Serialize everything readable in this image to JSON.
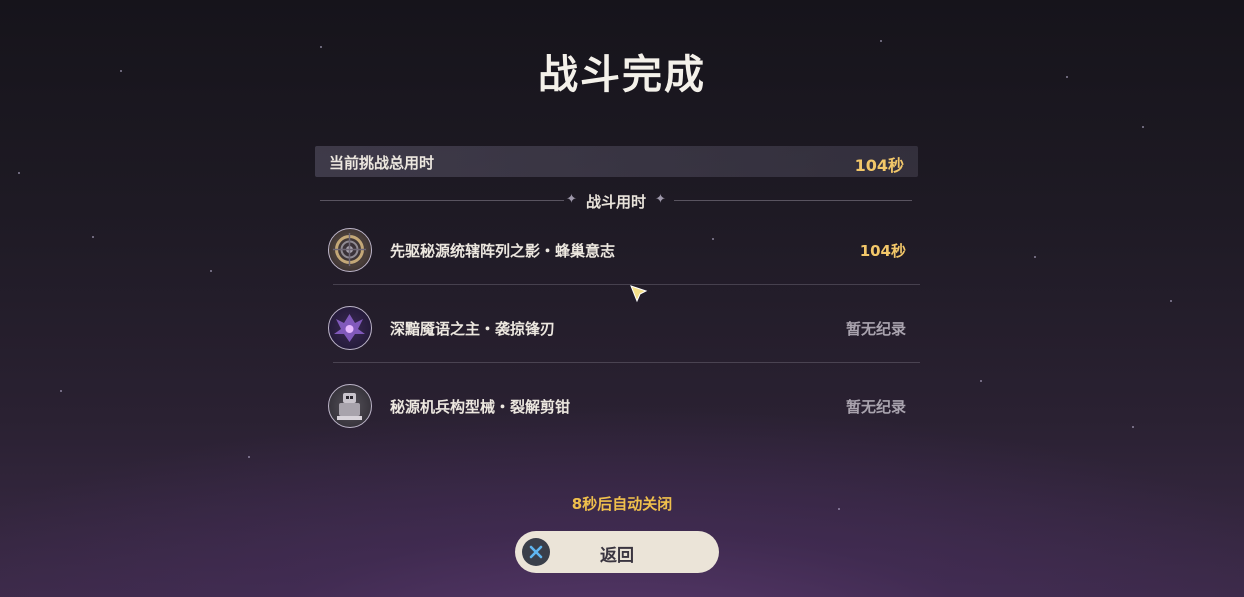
{
  "title": "战斗完成",
  "total": {
    "label": "当前挑战总用时",
    "value": "104秒"
  },
  "section": {
    "label": "战斗用时"
  },
  "bosses": [
    {
      "name": "先驱秘源统辖阵列之影・蜂巢意志",
      "time": "104秒",
      "icon": "mechanical-core-icon",
      "time_color": "#f2c769"
    },
    {
      "name": "深黯魇语之主・袭掠锋刃",
      "time": "暂无纪录",
      "icon": "dark-dragon-icon",
      "time_color": "#a9a3ae"
    },
    {
      "name": "秘源机兵构型械・裂解剪钳",
      "time": "暂无纪录",
      "icon": "construct-icon",
      "time_color": "#a9a3ae"
    }
  ],
  "auto_close": "8秒后自动关闭",
  "return_button": {
    "label": "返回",
    "icon": "close-x-icon"
  },
  "colors": {
    "gold": "#f2c769",
    "button_bg": "#ebe4d8",
    "button_icon": "#3a3f4a"
  }
}
